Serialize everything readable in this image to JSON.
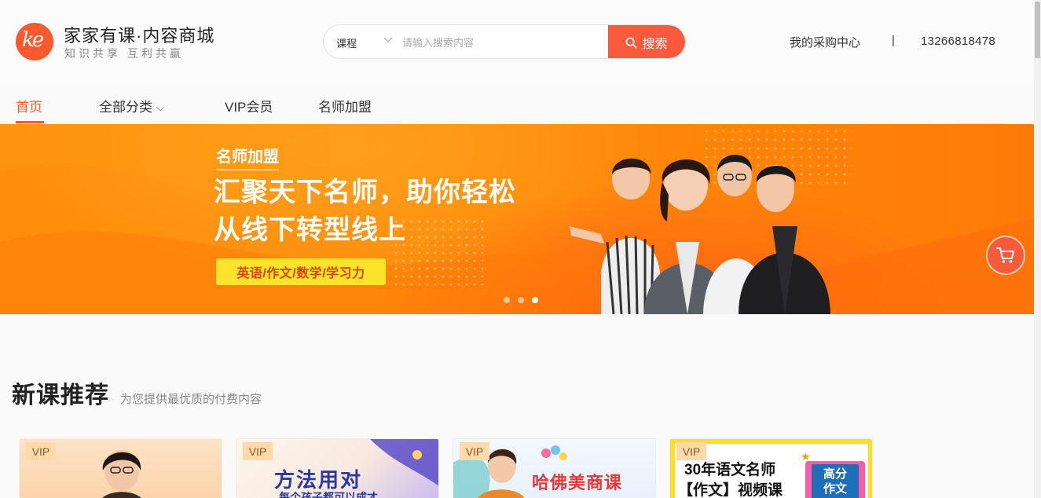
{
  "brand": {
    "logo_text": "ke",
    "title": "家家有课·内容商城",
    "slogan": "知识共享  互利共赢"
  },
  "search": {
    "category": "课程",
    "placeholder": "请输入搜索内容",
    "value": "",
    "button_label": "搜索"
  },
  "header_links": {
    "purchase_center": "我的采购中心",
    "divider": "|",
    "phone": "13266818478"
  },
  "nav": {
    "items": [
      {
        "label": "首页",
        "active": true
      },
      {
        "label": "全部分类",
        "has_dropdown": true
      },
      {
        "label": "VIP会员"
      },
      {
        "label": "名师加盟"
      }
    ]
  },
  "banner": {
    "tag": "名师加盟",
    "headline_line1": "汇聚天下名师，助你轻松",
    "headline_line2": "从线下转型线上",
    "subjects": "英语/作文/数学/学习力",
    "slides_total": 3,
    "active_slide": 3
  },
  "section": {
    "title": "新课推荐",
    "subtitle": "为您提供最优质的付费内容"
  },
  "cards": [
    {
      "badge": "VIP",
      "text": ""
    },
    {
      "badge": "VIP",
      "text": "方法用对",
      "subtext": "每个孩子都可以成才"
    },
    {
      "badge": "VIP",
      "text": "哈佛美商课",
      "subtext": ""
    },
    {
      "badge": "VIP",
      "text": "30年语文名师",
      "text2": "【作文】视频课",
      "sign_line1": "高分",
      "sign_line2": "作文"
    }
  ],
  "colors": {
    "accent": "#fa5a2e",
    "banner_orange": "#ff8b0a",
    "pill_yellow": "#ffe32b",
    "vip_badge": "#ffd9a8"
  },
  "icons": {
    "search": "search-icon",
    "cart": "shopping-cart-icon",
    "chevron": "chevron-down-icon"
  }
}
